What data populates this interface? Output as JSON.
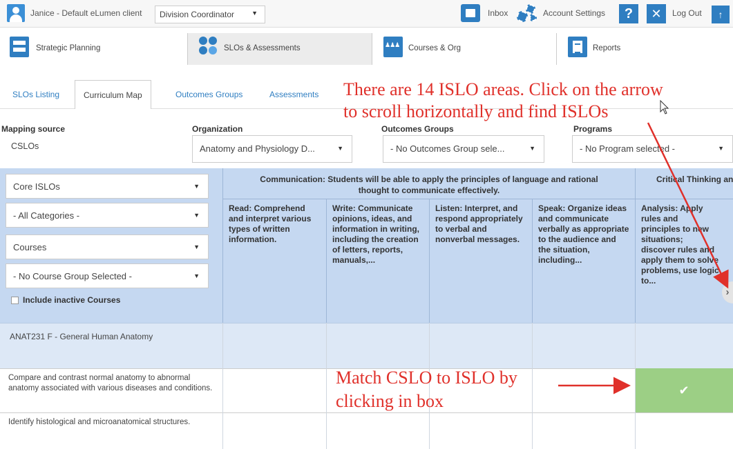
{
  "topbar": {
    "user": "Janice - Default eLumen client",
    "role": "Division Coordinator",
    "inbox": "Inbox",
    "account_settings": "Account Settings",
    "help": "?",
    "logout_icon": "✕",
    "logout": "Log Out",
    "up": "↑"
  },
  "modules": [
    {
      "label": "Strategic Planning",
      "icon": "strategic-planning-icon"
    },
    {
      "label": "SLOs & Assessments",
      "icon": "slo-assessments-icon"
    },
    {
      "label": "Courses & Org",
      "icon": "courses-org-icon"
    },
    {
      "label": "Reports",
      "icon": "reports-icon"
    }
  ],
  "subtabs": [
    "SLOs Listing",
    "Curriculum Map",
    "Outcomes Groups",
    "Assessments"
  ],
  "filters": {
    "mapping_source": {
      "label": "Mapping source",
      "value": "CSLOs"
    },
    "organization": {
      "label": "Organization",
      "value": "Anatomy and Physiology D..."
    },
    "outcomes_groups": {
      "label": "Outcomes Groups",
      "value": "- No Outcomes Group sele..."
    },
    "programs": {
      "label": "Programs",
      "value": "- No Program selected -"
    }
  },
  "panel": {
    "islo_select": "Core ISLOs",
    "category_select": "- All Categories -",
    "type_select": "Courses",
    "course_group_select": "- No Course Group Selected -",
    "include_inactive": "Include inactive Courses"
  },
  "grid": {
    "group_communication": "Communication: Students will be able to apply the principles of language and rational thought to communicate effectively.",
    "group_critical": "Critical Thinking and analyzing data",
    "islos": [
      "Read: Comprehend and interpret various types of written information.",
      "Write: Communicate opinions, ideas, and information in writing, including the creation of letters, reports, manuals,...",
      "Listen: Interpret, and respond appropriately to verbal and nonverbal messages.",
      "Speak: Organize ideas and communicate verbally as appropriate to the audience and the situation, including...",
      "Analysis: Apply rules and principles to new situations; discover rules and apply them to solve problems, use logic to..."
    ],
    "course": "ANAT231 F - General Human Anatomy",
    "cslos": [
      "Compare and contrast normal anatomy to abnormal anatomy associated with various diseases and conditions.",
      "Identify histological and microanatomical structures."
    ],
    "checkmark": "✔",
    "scroll_arrow": "›"
  },
  "annotations": {
    "top_line1": "There are 14 ISLO areas.  Click on the arrow",
    "top_line2": "to scroll horizontally and find ISLOs",
    "bottom_line1": "Match CSLO to ISLO by",
    "bottom_line2": "clicking in box"
  },
  "colors": {
    "accent": "#2f7ec1",
    "header_blue": "#c5d8f1",
    "mapped_green": "#9ccf85",
    "annotation_red": "#e0302a"
  }
}
